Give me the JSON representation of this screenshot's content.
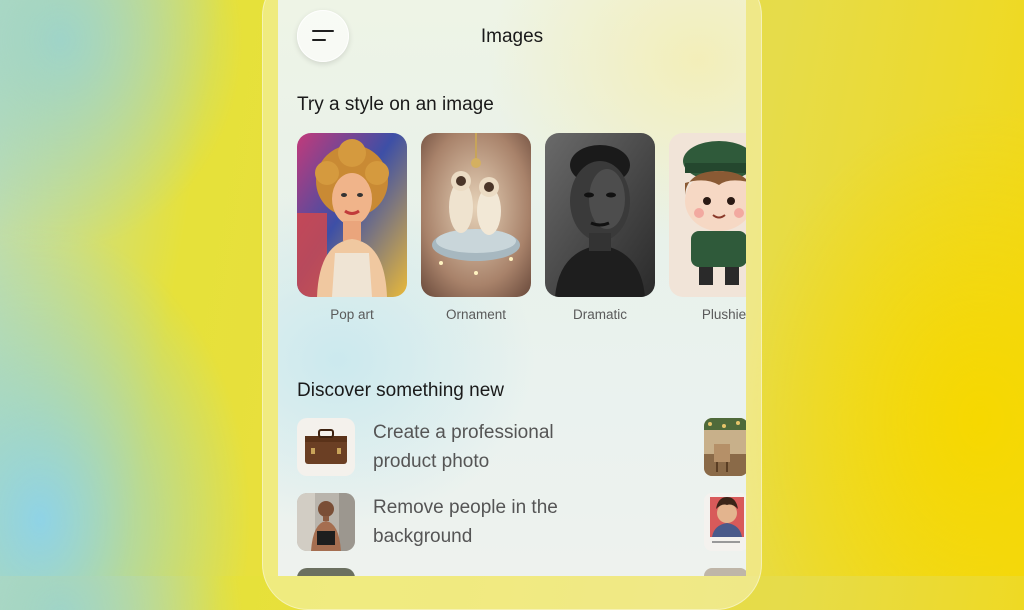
{
  "header": {
    "title": "Images",
    "menu_icon": "menu-icon"
  },
  "styles_section": {
    "title": "Try a style on an image",
    "items": [
      {
        "label": "Pop art"
      },
      {
        "label": "Ornament"
      },
      {
        "label": "Dramatic"
      },
      {
        "label": "Plushie"
      }
    ]
  },
  "discover_section": {
    "title": "Discover something new",
    "items": [
      {
        "line1": "Create a professional",
        "line2": "product photo"
      },
      {
        "line1": "Remove people in the",
        "line2": "background"
      }
    ]
  }
}
